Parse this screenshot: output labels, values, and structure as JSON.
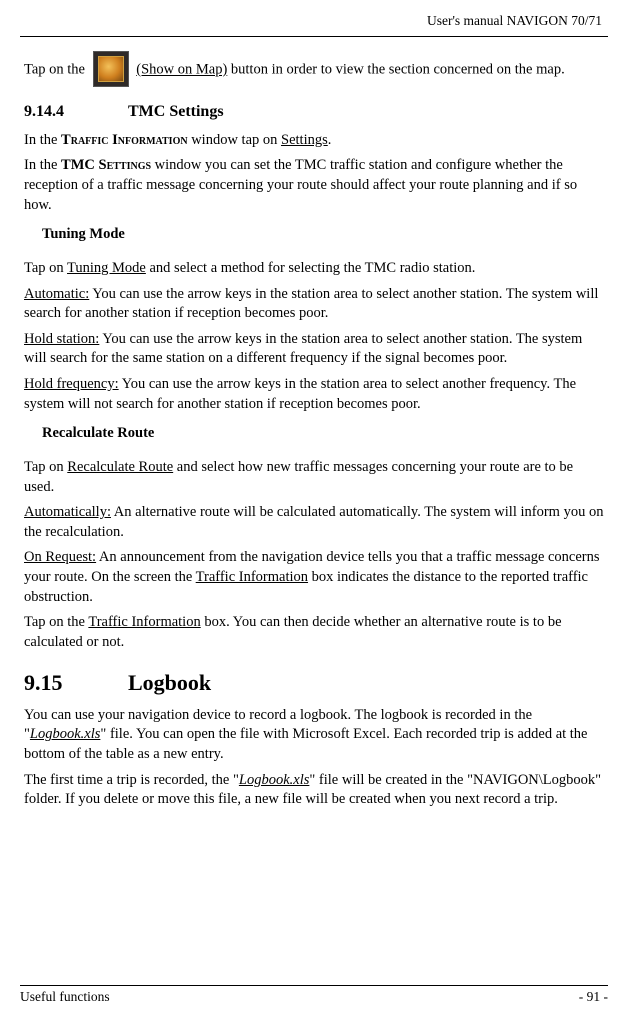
{
  "header": {
    "running_title": "User's manual NAVIGON 70/71"
  },
  "footer": {
    "left": "Useful functions",
    "right": "- 91 -"
  },
  "intro": {
    "tap_on_the": "Tap on the ",
    "button_label": "(Show on Map)",
    "tail": " button in order to view the section concerned on the map."
  },
  "sec_9_14_4": {
    "num": "9.14.4",
    "title": "TMC Settings",
    "line1_a": "In the ",
    "line1_b": "Traffic Information",
    "line1_c": " window tap on ",
    "line1_d": "Settings",
    "line1_e": ".",
    "line2_a": "In the ",
    "line2_b": "TMC Settings",
    "line2_c": " window you can set the TMC traffic station and configure whether the reception of a traffic message concerning your route should affect your route planning and if so how."
  },
  "tuning": {
    "heading": "Tuning Mode",
    "intro_a": "Tap on ",
    "intro_b": "Tuning Mode",
    "intro_c": " and select a method for selecting the TMC radio station.",
    "auto_label": "Automatic:",
    "auto_body": " You can use the arrow keys in the station area to select another station. The system will search for another station if reception becomes poor.",
    "hold_station_label": "Hold station:",
    "hold_station_body": " You can use the arrow keys in the station area to select another station. The system will search for the same station on a different frequency if the signal becomes poor.",
    "hold_freq_label": "Hold frequency:",
    "hold_freq_body": " You can use the arrow keys in the station area to select another frequency. The system will not search for another station if reception becomes poor."
  },
  "recalc": {
    "heading": "Recalculate Route",
    "intro_a": "Tap on ",
    "intro_b": "Recalculate Route",
    "intro_c": " and select how new traffic messages concerning your route are to be used.",
    "auto_label": "Automatically:",
    "auto_body": " An alternative route will be calculated automatically. The system will inform you on the recalculation.",
    "onreq_label": "On Request:",
    "onreq_body_a": " An announcement from the navigation device tells you that a traffic message concerns your route. On the screen the ",
    "onreq_body_b": "Traffic Information",
    "onreq_body_c": " box indicates the distance to the reported traffic obstruction.",
    "tap_a": "Tap on the ",
    "tap_b": "Traffic Information",
    "tap_c": " box. You can then decide whether an alternative route is to be calculated or not."
  },
  "sec_9_15": {
    "num": "9.15",
    "title": "Logbook",
    "p1_a": "You can use your navigation device to record a logbook. The logbook is recorded in the \"",
    "p1_file": "Logbook.xls",
    "p1_b": "\" file. You can open the file with Microsoft Excel. Each recorded trip is added at the bottom of the table as a new entry.",
    "p2_a": "The first time a trip is recorded, the \"",
    "p2_file": "Logbook.xls",
    "p2_b": "\" file will be created in the \"NAVIGON\\Logbook\" folder. If you delete or move this file, a new file will be created when you next record a trip."
  }
}
